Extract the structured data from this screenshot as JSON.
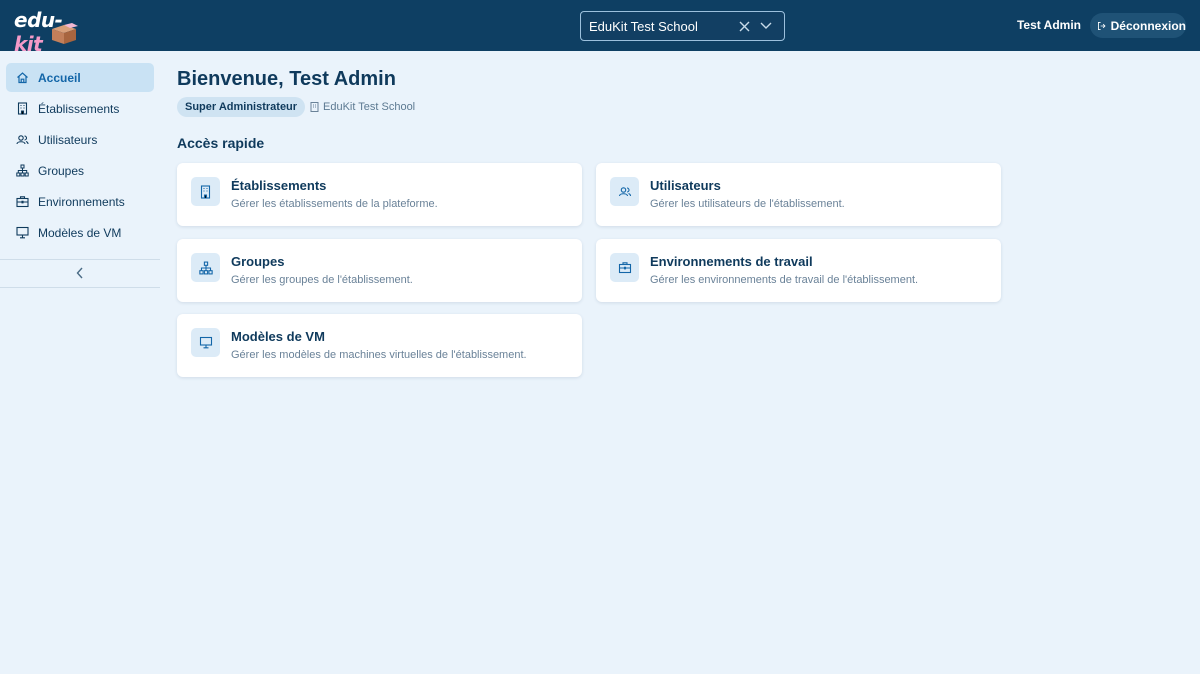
{
  "header": {
    "logo_text_main": "edu-",
    "logo_text_accent": "kit",
    "school_select": {
      "value": "EduKit Test School"
    },
    "user_name": "Test Admin",
    "logout_label": "Déconnexion"
  },
  "sidebar": {
    "items": [
      {
        "label": "Accueil",
        "icon": "home-icon",
        "active": true
      },
      {
        "label": "Établissements",
        "icon": "building-icon",
        "active": false
      },
      {
        "label": "Utilisateurs",
        "icon": "users-icon",
        "active": false
      },
      {
        "label": "Groupes",
        "icon": "network-icon",
        "active": false
      },
      {
        "label": "Environnements",
        "icon": "briefcase-icon",
        "active": false
      },
      {
        "label": "Modèles de VM",
        "icon": "monitor-icon",
        "active": false
      }
    ]
  },
  "main": {
    "title": "Bienvenue, Test Admin",
    "role_badge": "Super Administrateur",
    "school_tag": "EduKit Test School",
    "section_title": "Accès rapide",
    "cards": [
      {
        "title": "Établissements",
        "desc": "Gérer les établissements de la plateforme.",
        "icon": "building-icon"
      },
      {
        "title": "Utilisateurs",
        "desc": "Gérer les utilisateurs de l'établissement.",
        "icon": "users-icon"
      },
      {
        "title": "Groupes",
        "desc": "Gérer les groupes de l'établissement.",
        "icon": "network-icon"
      },
      {
        "title": "Environnements de travail",
        "desc": "Gérer les environnements de travail de l'établissement.",
        "icon": "briefcase-icon"
      },
      {
        "title": "Modèles de VM",
        "desc": "Gérer les modèles de machines virtuelles de l'établissement.",
        "icon": "monitor-icon"
      }
    ]
  },
  "colors": {
    "header_bg": "#0e3f63",
    "page_bg": "#eaf3fb",
    "active_nav_bg": "#c9e2f4",
    "accent": "#1366a8"
  }
}
